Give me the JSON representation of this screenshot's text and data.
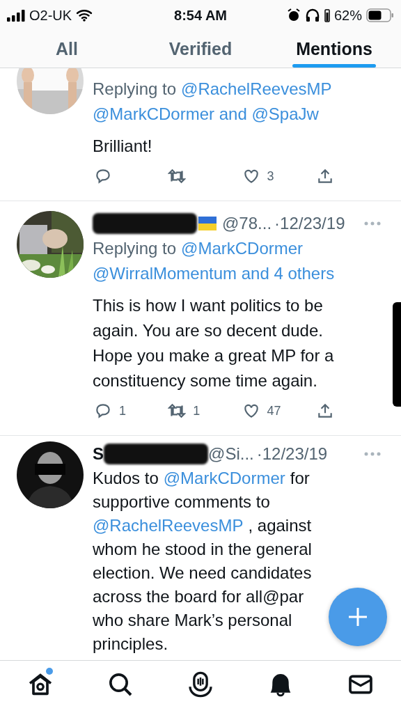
{
  "status_bar": {
    "carrier": "O2-UK",
    "time": "8:54 AM",
    "battery_text": "62%"
  },
  "tabs": [
    {
      "label": "All",
      "selected": false
    },
    {
      "label": "Verified",
      "selected": false
    },
    {
      "label": "Mentions",
      "selected": true
    }
  ],
  "tweets": [
    {
      "avatar": {
        "kind": "picture"
      },
      "replying": [
        [
          {
            "kind": "text",
            "text": "Replying to"
          },
          {
            "kind": "mention",
            "text": "@RachelReevesMP"
          }
        ],
        [
          {
            "kind": "mention",
            "text": "@MarkCDormer and @SpaJw"
          }
        ]
      ],
      "body": [
        [
          {
            "kind": "text",
            "text": "Brilliant!"
          }
        ]
      ],
      "actions": {
        "likes": "3"
      }
    },
    {
      "avatar": {
        "kind": "picture"
      },
      "header": {
        "redacted": true,
        "flag": true,
        "handle": "@78...",
        "date": "·12/23/19"
      },
      "replying": [
        [
          {
            "kind": "text",
            "text": "Replying to"
          },
          {
            "kind": "mention",
            "text": "@MarkCDormer"
          }
        ],
        [
          {
            "kind": "mention",
            "text": "@WirralMomentum and 4 others"
          }
        ]
      ],
      "body": [
        [
          {
            "kind": "text",
            "text": "This is how I want politics to be"
          }
        ],
        [
          {
            "kind": "text",
            "text": "again. You are so decent dude."
          }
        ],
        [
          {
            "kind": "text",
            "text": "Hope you make a great MP for a"
          }
        ],
        [
          {
            "kind": "text",
            "text": "constituency some time again."
          }
        ]
      ],
      "actions": {
        "replies": "1",
        "retweets": "1",
        "likes": "47"
      },
      "side_redaction": true
    },
    {
      "avatar": {
        "kind": "picture"
      },
      "header": {
        "name_visible": "S",
        "redacted": true,
        "handle": "@Si...",
        "date": "·12/23/19"
      },
      "body": [
        [
          {
            "kind": "text",
            "text": "Kudos to"
          },
          {
            "kind": "mention",
            "text": "@MarkCDormer"
          },
          {
            "kind": "text",
            "text": "for"
          }
        ],
        [
          {
            "kind": "text",
            "text": "supportive comments to"
          }
        ],
        [
          {
            "kind": "mention",
            "text": "@RachelReevesMP"
          },
          {
            "kind": "text",
            "text": ", against"
          }
        ],
        [
          {
            "kind": "text",
            "text": "whom he stood in the general"
          }
        ],
        [
          {
            "kind": "text",
            "text": "election. We need candidates"
          }
        ],
        [
          {
            "kind": "text",
            "text": "across the board for all@par"
          }
        ],
        [
          {
            "kind": "text",
            "text": "who share Mark’s personal"
          }
        ],
        [
          {
            "kind": "text",
            "text": "principles."
          }
        ]
      ]
    }
  ],
  "nav": [
    {
      "badge": true
    },
    {
      "badge": false
    },
    {
      "badge": false
    },
    {
      "badge": false
    },
    {
      "badge": false
    }
  ],
  "compose_button": true
}
